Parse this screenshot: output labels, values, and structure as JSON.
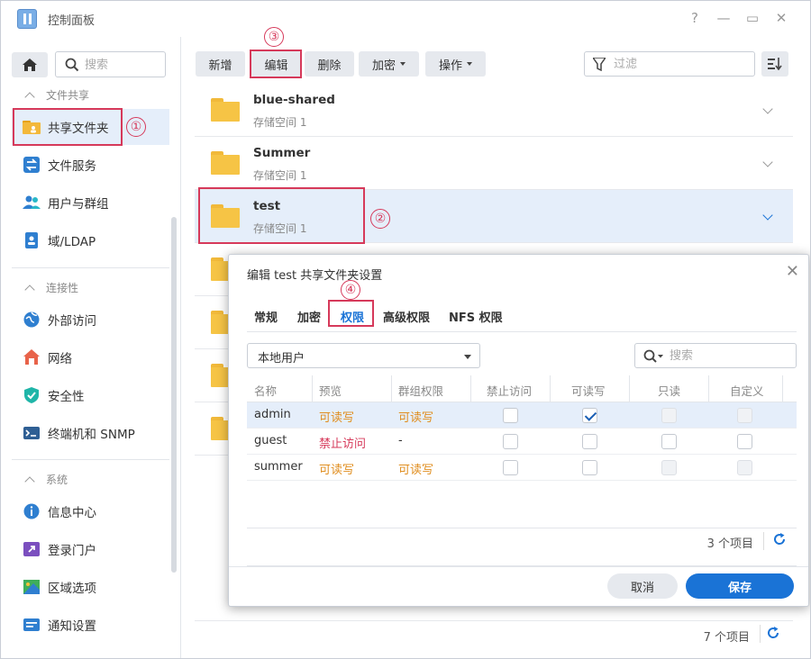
{
  "window": {
    "title": "控制面板",
    "help": "?",
    "minimize": "—",
    "maximize": "▭",
    "close": "✕"
  },
  "sidebar": {
    "search_placeholder": "搜索",
    "sections": [
      {
        "label": "文件共享",
        "items": [
          "共享文件夹",
          "文件服务",
          "用户与群组",
          "域/LDAP"
        ]
      },
      {
        "label": "连接性",
        "items": [
          "外部访问",
          "网络",
          "安全性",
          "终端机和 SNMP"
        ]
      },
      {
        "label": "系统",
        "items": [
          "信息中心",
          "登录门户",
          "区域选项",
          "通知设置"
        ]
      }
    ]
  },
  "toolbar": {
    "create": "新增",
    "edit": "编辑",
    "delete": "删除",
    "encrypt": "加密",
    "action": "操作",
    "filter_placeholder": "过滤"
  },
  "folders": [
    {
      "name": "blue-shared",
      "sub": "存储空间 1"
    },
    {
      "name": "Summer",
      "sub": "存储空间 1"
    },
    {
      "name": "test",
      "sub": "存储空间 1"
    }
  ],
  "main_footer": {
    "count": "7 个项目"
  },
  "annotations": [
    "①",
    "②",
    "③",
    "④"
  ],
  "dialog": {
    "title": "编辑 test 共享文件夹设置",
    "close": "✕",
    "tabs": [
      "常规",
      "加密",
      "权限",
      "高级权限",
      "NFS 权限"
    ],
    "active_tab": "权限",
    "user_type": "本地用户",
    "search_placeholder": "搜索",
    "columns": [
      "名称",
      "预览",
      "群组权限",
      "禁止访问",
      "可读写",
      "只读",
      "自定义"
    ],
    "rows": [
      {
        "name": "admin",
        "preview": "可读写",
        "group": "可读写",
        "deny": false,
        "rw": true,
        "ro": false,
        "custom": false
      },
      {
        "name": "guest",
        "preview": "禁止访问",
        "group": "-",
        "deny": false,
        "rw": false,
        "ro": false,
        "custom": false
      },
      {
        "name": "summer",
        "preview": "可读写",
        "group": "可读写",
        "deny": false,
        "rw": false,
        "ro": false,
        "custom": false
      }
    ],
    "count": "3 个项目",
    "cancel": "取消",
    "save": "保存"
  },
  "colors": {
    "accent": "#1a73d6",
    "highlight": "#d6395a",
    "folder": "#f6c445",
    "ok": "#e08e1f",
    "deny": "#d6395a"
  }
}
